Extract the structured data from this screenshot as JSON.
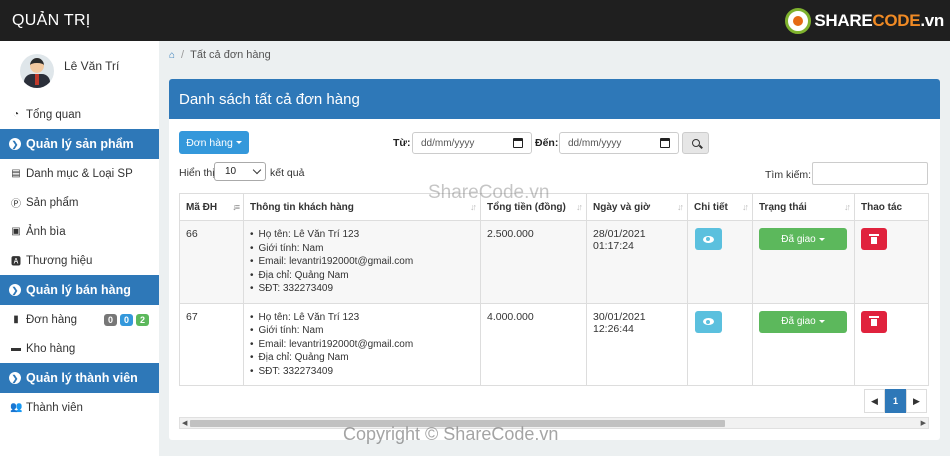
{
  "app": {
    "title": "QUẢN TRỊ"
  },
  "logo": {
    "prefix": "SHARE",
    "suffix": "CODE",
    "domain": ".vn"
  },
  "user": {
    "name": "Lê Văn Trí"
  },
  "sidebar": {
    "overview": "Tổng quan",
    "section_products": "Quản lý sản phẩm",
    "categories": "Danh mục & Loại SP",
    "products": "Sản phẩm",
    "covers": "Ảnh bìa",
    "brands": "Thương hiệu",
    "section_sales": "Quản lý bán hàng",
    "orders": "Đơn hàng",
    "order_badges": [
      {
        "value": "0",
        "color": "#777777"
      },
      {
        "value": "0",
        "color": "#3498db"
      },
      {
        "value": "2",
        "color": "#5cb85c"
      }
    ],
    "warehouse": "Kho hàng",
    "section_members": "Quản lý thành viên",
    "members": "Thành viên"
  },
  "breadcrumb": {
    "current": "Tất cả đơn hàng"
  },
  "panel": {
    "title": "Danh sách tất cả đơn hàng"
  },
  "filters": {
    "order_button": "Đơn hàng",
    "from_label": "Từ:",
    "to_label": "Đến:",
    "from_placeholder": "dd/mm/yyyy",
    "to_placeholder": "dd/mm/yyyy"
  },
  "table_controls": {
    "show_label": "Hiển thị",
    "page_length": "10",
    "results_label": "kết quả",
    "search_label": "Tìm kiếm:"
  },
  "table": {
    "headers": [
      "Mã ĐH",
      "Thông tin khách hàng",
      "Tổng tiền (đồng)",
      "Ngày và giờ",
      "Chi tiết",
      "Trạng thái",
      "Thao tác"
    ],
    "rows": [
      {
        "id": "66",
        "customer": [
          "Họ tên: Lê Văn Trí 123",
          "Giới tính: Nam",
          "Email: levantri192000t@gmail.com",
          "Địa chỉ: Quảng Nam",
          "SĐT: 332273409"
        ],
        "total": "2.500.000",
        "date": "28/01/2021",
        "time": "01:17:24",
        "status": "Đã giao"
      },
      {
        "id": "67",
        "customer": [
          "Họ tên: Lê Văn Trí 123",
          "Giới tính: Nam",
          "Email: levantri192000t@gmail.com",
          "Địa chỉ: Quảng Nam",
          "SĐT: 332273409"
        ],
        "total": "4.000.000",
        "date": "30/01/2021",
        "time": "12:26:44",
        "status": "Đã giao"
      }
    ]
  },
  "pagination": {
    "current_page": "1"
  },
  "watermarks": {
    "center": "ShareCode.vn",
    "bottom": "Copyright © ShareCode.vn"
  },
  "colors": {
    "primary": "#2e78b8",
    "success": "#5cb85c",
    "info": "#5bc0de",
    "danger": "#e0223d",
    "topbar": "#1f1f1f"
  }
}
